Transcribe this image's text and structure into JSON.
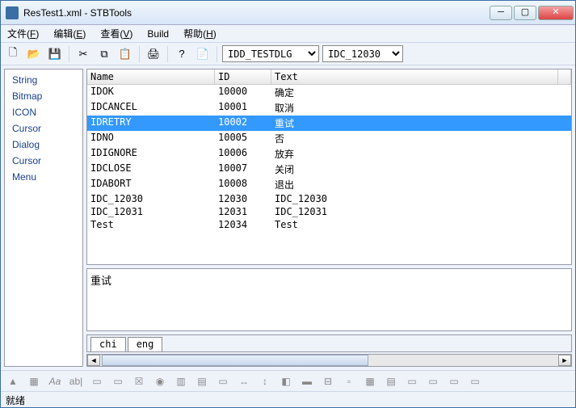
{
  "window": {
    "title": "ResTest1.xml - STBTools"
  },
  "menu": {
    "file": {
      "label": "文件",
      "accel": "F"
    },
    "edit": {
      "label": "编辑",
      "accel": "E"
    },
    "view": {
      "label": "查看",
      "accel": "V"
    },
    "build": {
      "label": "Build"
    },
    "help": {
      "label": "帮助",
      "accel": "H"
    }
  },
  "toolbar": {
    "dropdown1": "IDD_TESTDLG",
    "dropdown2": "IDC_12030"
  },
  "sidebar": {
    "items": [
      "String",
      "Bitmap",
      "ICON",
      "Cursor",
      "Dialog",
      "Cursor",
      "Menu"
    ]
  },
  "table": {
    "headers": {
      "name": "Name",
      "id": "ID",
      "text": "Text"
    },
    "rows": [
      {
        "name": "IDOK",
        "id": "10000",
        "text": "确定",
        "sel": false
      },
      {
        "name": "IDCANCEL",
        "id": "10001",
        "text": "取消",
        "sel": false
      },
      {
        "name": "IDRETRY",
        "id": "10002",
        "text": "重试",
        "sel": true
      },
      {
        "name": "IDNO",
        "id": "10005",
        "text": "否",
        "sel": false
      },
      {
        "name": "IDIGNORE",
        "id": "10006",
        "text": "放弃",
        "sel": false
      },
      {
        "name": "IDCLOSE",
        "id": "10007",
        "text": "关闭",
        "sel": false
      },
      {
        "name": "IDABORT",
        "id": "10008",
        "text": "退出",
        "sel": false
      },
      {
        "name": "IDC_12030",
        "id": "12030",
        "text": "IDC_12030",
        "sel": false
      },
      {
        "name": "IDC_12031",
        "id": "12031",
        "text": "IDC_12031",
        "sel": false
      },
      {
        "name": "Test",
        "id": "12034",
        "text": "Test",
        "sel": false
      }
    ]
  },
  "detail": {
    "text": "重试"
  },
  "langtabs": {
    "tabs": [
      "chi",
      "eng"
    ]
  },
  "status": {
    "text": "就绪"
  }
}
